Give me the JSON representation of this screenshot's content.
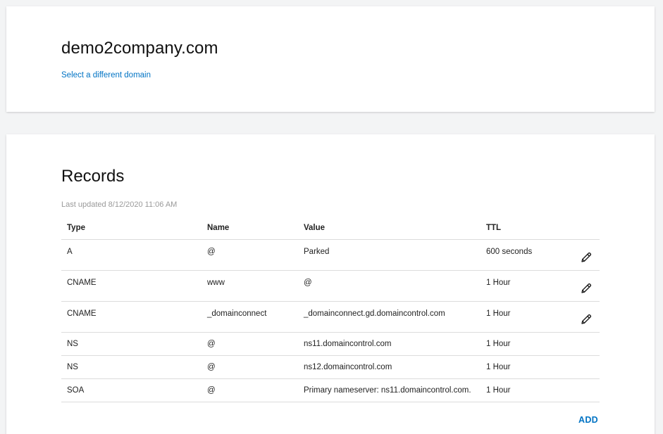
{
  "domain": {
    "name": "demo2company.com",
    "select_link": "Select a different domain"
  },
  "records": {
    "title": "Records",
    "last_updated": "Last updated 8/12/2020 11:06 AM",
    "columns": [
      "Type",
      "Name",
      "Value",
      "TTL"
    ],
    "rows": [
      {
        "type": "A",
        "name": "@",
        "value": "Parked",
        "ttl": "600 seconds",
        "editable": true
      },
      {
        "type": "CNAME",
        "name": "www",
        "value": "@",
        "ttl": "1 Hour",
        "editable": true
      },
      {
        "type": "CNAME",
        "name": "_domainconnect",
        "value": "_domainconnect.gd.domaincontrol.com",
        "ttl": "1 Hour",
        "editable": true
      },
      {
        "type": "NS",
        "name": "@",
        "value": "ns11.domaincontrol.com",
        "ttl": "1 Hour",
        "editable": false
      },
      {
        "type": "NS",
        "name": "@",
        "value": "ns12.domaincontrol.com",
        "ttl": "1 Hour",
        "editable": false
      },
      {
        "type": "SOA",
        "name": "@",
        "value": "Primary nameserver: ns11.domaincontrol.com.",
        "ttl": "1 Hour",
        "editable": false
      }
    ],
    "edit_icon": "pencil-icon",
    "add_label": "ADD"
  },
  "colors": {
    "accent": "#0073c4",
    "background": "#f3f4f5",
    "muted_text": "#9a9a9a"
  }
}
